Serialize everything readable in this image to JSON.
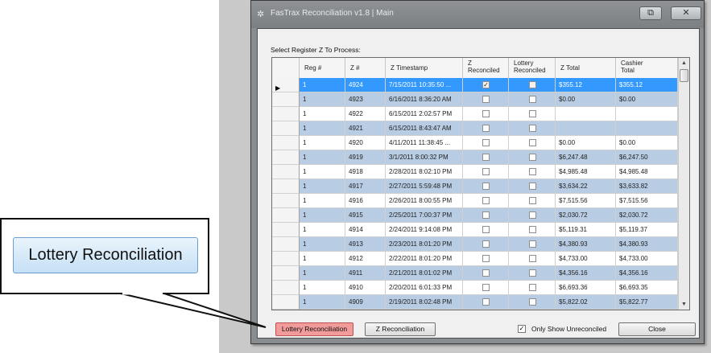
{
  "window": {
    "title": "FasTrax Reconciliation v1.8 | Main",
    "app_icon": "gear-icon",
    "restore_icon": "restore-window-icon",
    "close_icon": "close-icon",
    "restore_glyph": "⧉",
    "close_glyph": "✕",
    "app_glyph": "✲"
  },
  "label_select": "Select Register Z To Process:",
  "grid": {
    "columns": [
      {
        "line1": "Reg #",
        "line2": ""
      },
      {
        "line1": "Z #",
        "line2": ""
      },
      {
        "line1": "Z Timestamp",
        "line2": ""
      },
      {
        "line1": "Z",
        "line2": "Reconciled"
      },
      {
        "line1": "Lottery",
        "line2": "Reconciled"
      },
      {
        "line1": "Z Total",
        "line2": ""
      },
      {
        "line1": "Cashier",
        "line2": "Total"
      }
    ],
    "rows": [
      {
        "reg": "1",
        "z": "4924",
        "ts": "7/15/2011 10:35:50 ...",
        "zrec": true,
        "lrec": false,
        "ztotal": "$355.12",
        "cashier": "$355.12"
      },
      {
        "reg": "1",
        "z": "4923",
        "ts": "6/16/2011 8:36:20 AM",
        "zrec": false,
        "lrec": false,
        "ztotal": "$0.00",
        "cashier": "$0.00"
      },
      {
        "reg": "1",
        "z": "4922",
        "ts": "6/15/2011 2:02:57 PM",
        "zrec": false,
        "lrec": false,
        "ztotal": "",
        "cashier": ""
      },
      {
        "reg": "1",
        "z": "4921",
        "ts": "6/15/2011 8:43:47 AM",
        "zrec": false,
        "lrec": false,
        "ztotal": "",
        "cashier": ""
      },
      {
        "reg": "1",
        "z": "4920",
        "ts": "4/11/2011 11:38:45 ...",
        "zrec": false,
        "lrec": false,
        "ztotal": "$0.00",
        "cashier": "$0.00"
      },
      {
        "reg": "1",
        "z": "4919",
        "ts": "3/1/2011 8:00:32 PM",
        "zrec": false,
        "lrec": false,
        "ztotal": "$6,247.48",
        "cashier": "$6,247.50"
      },
      {
        "reg": "1",
        "z": "4918",
        "ts": "2/28/2011 8:02:10 PM",
        "zrec": false,
        "lrec": false,
        "ztotal": "$4,985.48",
        "cashier": "$4,985.48"
      },
      {
        "reg": "1",
        "z": "4917",
        "ts": "2/27/2011 5:59:48 PM",
        "zrec": false,
        "lrec": false,
        "ztotal": "$3,634.22",
        "cashier": "$3,633.82"
      },
      {
        "reg": "1",
        "z": "4916",
        "ts": "2/26/2011 8:00:55 PM",
        "zrec": false,
        "lrec": false,
        "ztotal": "$7,515.56",
        "cashier": "$7,515.56"
      },
      {
        "reg": "1",
        "z": "4915",
        "ts": "2/25/2011 7:00:37 PM",
        "zrec": false,
        "lrec": false,
        "ztotal": "$2,030.72",
        "cashier": "$2,030.72"
      },
      {
        "reg": "1",
        "z": "4914",
        "ts": "2/24/2011 9:14:08 PM",
        "zrec": false,
        "lrec": false,
        "ztotal": "$5,119.31",
        "cashier": "$5,119.37"
      },
      {
        "reg": "1",
        "z": "4913",
        "ts": "2/23/2011 8:01:20 PM",
        "zrec": false,
        "lrec": false,
        "ztotal": "$4,380.93",
        "cashier": "$4,380.93"
      },
      {
        "reg": "1",
        "z": "4912",
        "ts": "2/22/2011 8:01:20 PM",
        "zrec": false,
        "lrec": false,
        "ztotal": "$4,733.00",
        "cashier": "$4,733.00"
      },
      {
        "reg": "1",
        "z": "4911",
        "ts": "2/21/2011 8:01:02 PM",
        "zrec": false,
        "lrec": false,
        "ztotal": "$4,356.16",
        "cashier": "$4,356.16"
      },
      {
        "reg": "1",
        "z": "4910",
        "ts": "2/20/2011 6:01:33 PM",
        "zrec": false,
        "lrec": false,
        "ztotal": "$6,693.36",
        "cashier": "$6,693.35"
      },
      {
        "reg": "1",
        "z": "4909",
        "ts": "2/19/2011 8:02:48 PM",
        "zrec": false,
        "lrec": false,
        "ztotal": "$5,822.02",
        "cashier": "$5,822.77"
      }
    ],
    "selected_row_index": 0,
    "row_indicator_glyph": "▶",
    "check_glyph": "✓",
    "scroll_up_glyph": "▲",
    "scroll_down_glyph": "▼"
  },
  "buttons": {
    "lottery": "Lottery Reconciliation",
    "z_reconciliation": "Z Reconciliation",
    "close": "Close"
  },
  "only_unreconciled": {
    "label": "Only Show Unreconciled",
    "checked": true,
    "glyph": "✓"
  },
  "callout": {
    "button_label": "Lottery Reconciliation"
  },
  "colors": {
    "selected_row": "#3399ff",
    "alternate_row": "#b8cce4",
    "highlight_button": "#f29b9b"
  }
}
